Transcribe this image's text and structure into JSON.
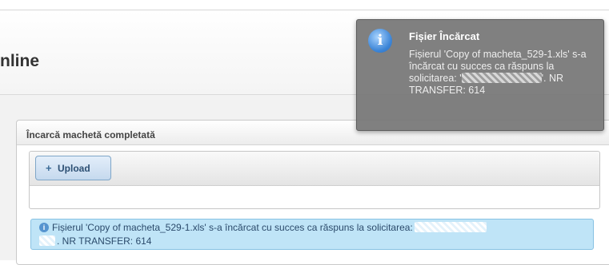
{
  "page": {
    "title": "nline"
  },
  "panel": {
    "title": "Încarcă machetă completată"
  },
  "upload": {
    "button_label": "Upload",
    "button_icon": "plus-icon"
  },
  "alert": {
    "icon": "info-icon",
    "line1_text": "Fișierul 'Copy of macheta_529-1.xls' s-a încărcat cu succes ca răspuns la solicitarea:",
    "line2_text": ". NR TRANSFER: 614",
    "background": "#bfe4f7"
  },
  "toast": {
    "icon": "info-icon",
    "title": "Fișier Încărcat",
    "message_part1": "Fișierul 'Copy of macheta_529-1.xls' s-a încărcat cu succes ca răspuns la solicitarea: '",
    "message_part2": "'. NR TRANSFER: 614",
    "background": "#767676"
  }
}
